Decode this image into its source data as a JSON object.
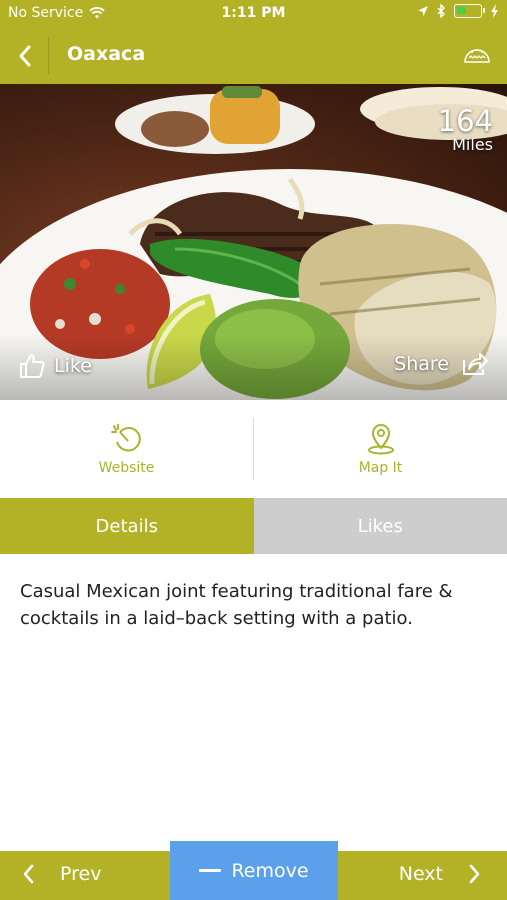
{
  "status_bar": {
    "carrier": "No Service",
    "time": "1:11 PM",
    "icons": [
      "wifi-icon",
      "location-arrow-icon",
      "bluetooth-icon",
      "battery-icon",
      "charging-bolt-icon"
    ]
  },
  "header": {
    "title": "Oaxaca",
    "back_icon": "chevron-left-icon",
    "right_icon": "taco-icon"
  },
  "hero": {
    "distance_value": "164",
    "distance_unit": "Miles",
    "like_label": "Like",
    "share_label": "Share"
  },
  "actions": {
    "website_label": "Website",
    "map_label": "Map It"
  },
  "tabs": [
    {
      "label": "Details",
      "active": true
    },
    {
      "label": "Likes",
      "active": false
    }
  ],
  "details": {
    "description": "Casual Mexican joint featuring traditional fare & cocktails in a laid–back setting with a patio."
  },
  "bottom_bar": {
    "prev_label": "Prev",
    "remove_label": "Remove",
    "next_label": "Next"
  },
  "colors": {
    "brand": "#b3b226",
    "remove_button": "#5aa0ea",
    "inactive_tab": "#cdcdcd",
    "action_text": "#a9b52c"
  }
}
